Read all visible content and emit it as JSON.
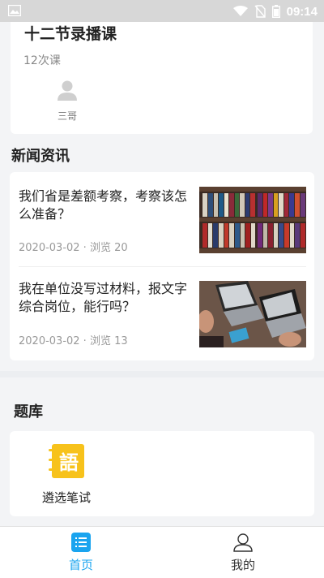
{
  "status_bar": {
    "time": "09:14"
  },
  "course": {
    "title": "十二节录播课",
    "count": "12次课",
    "teacher": "三哥"
  },
  "news": {
    "section_title": "新闻资讯",
    "items": [
      {
        "title": "我们省是差额考察，考察该怎么准备？",
        "meta": "2020-03-02 · 浏览 20",
        "thumb": "bookshelf-image"
      },
      {
        "title": "我在单位没写过材料，报文字综合岗位，能行吗？",
        "meta": "2020-03-02 · 浏览 13",
        "thumb": "desk-laptop-image"
      }
    ]
  },
  "question_bank": {
    "section_title": "题库",
    "items": [
      {
        "label": "遴选笔试",
        "icon": "yu-book-icon"
      }
    ]
  },
  "tabbar": {
    "items": [
      {
        "label": "首页",
        "icon": "home-list-icon",
        "active": true
      },
      {
        "label": "我的",
        "icon": "person-icon",
        "active": false
      }
    ],
    "active_color": "#1aa4ef",
    "inactive_color": "#333333"
  }
}
